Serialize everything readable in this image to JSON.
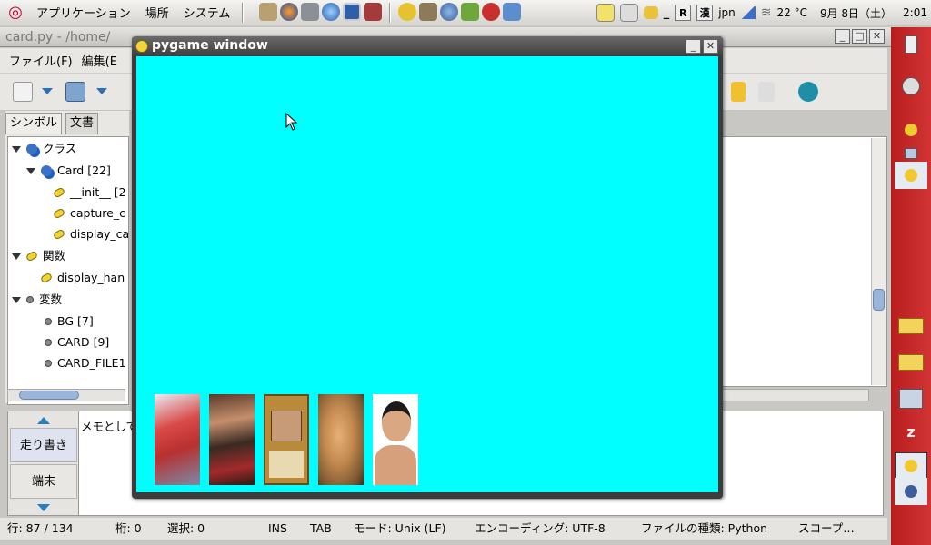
{
  "top_panel": {
    "menus": [
      "アプリケーション",
      "場所",
      "システム"
    ],
    "weather": "22 °C",
    "date": "9月 8日（土）",
    "time": "2:01",
    "keyboard": "jpn",
    "tray_r": "R",
    "tray_ime": "漢"
  },
  "editor": {
    "title": "card.py - /home/",
    "menus": [
      "ファイル(F)",
      "編集(E"
    ],
    "sidebar_tabs": [
      "シンボル",
      "文書"
    ],
    "tree": [
      {
        "label": "クラス",
        "icon": "class-icon",
        "level": 0,
        "expander": true
      },
      {
        "label": "Card [22]",
        "icon": "class-icon",
        "level": 1,
        "expander": true
      },
      {
        "label": "__init__ [2",
        "icon": "method-icon",
        "level": 2,
        "expander": false
      },
      {
        "label": "capture_c",
        "icon": "method-icon",
        "level": 2,
        "expander": false
      },
      {
        "label": "display_ca",
        "icon": "method-icon",
        "level": 2,
        "expander": false
      },
      {
        "label": "関数",
        "icon": "function-icon",
        "level": 0,
        "expander": true
      },
      {
        "label": "display_han",
        "icon": "function-icon",
        "level": 1,
        "expander": false
      },
      {
        "label": "変数",
        "icon": "variable-icon",
        "level": 0,
        "expander": true
      },
      {
        "label": "BG [7]",
        "icon": "variable-icon",
        "level": 1,
        "expander": false
      },
      {
        "label": "CARD [9]",
        "icon": "variable-icon",
        "level": 1,
        "expander": false
      },
      {
        "label": "CARD_FILE1",
        "icon": "variable-icon",
        "level": 1,
        "expander": false
      }
    ],
    "message_tabs": [
      "走り書き",
      "端末"
    ],
    "message_text": "メモとして",
    "status": {
      "line": "行: 87 / 134",
      "col": "桁: 0",
      "sel": "選択: 0",
      "ins": "INS",
      "tab": "TAB",
      "mode": "モード: Unix (LF)",
      "encoding": "エンコーディング: UTF-8",
      "filetype": "ファイルの種類: Python",
      "scope": "スコープ…"
    }
  },
  "pygame": {
    "title": "pygame window",
    "background": "#00ffff",
    "cards": [
      "red-hero-card",
      "group-photo-card",
      "trading-card",
      "face-closeup-card",
      "portrait-card"
    ]
  }
}
